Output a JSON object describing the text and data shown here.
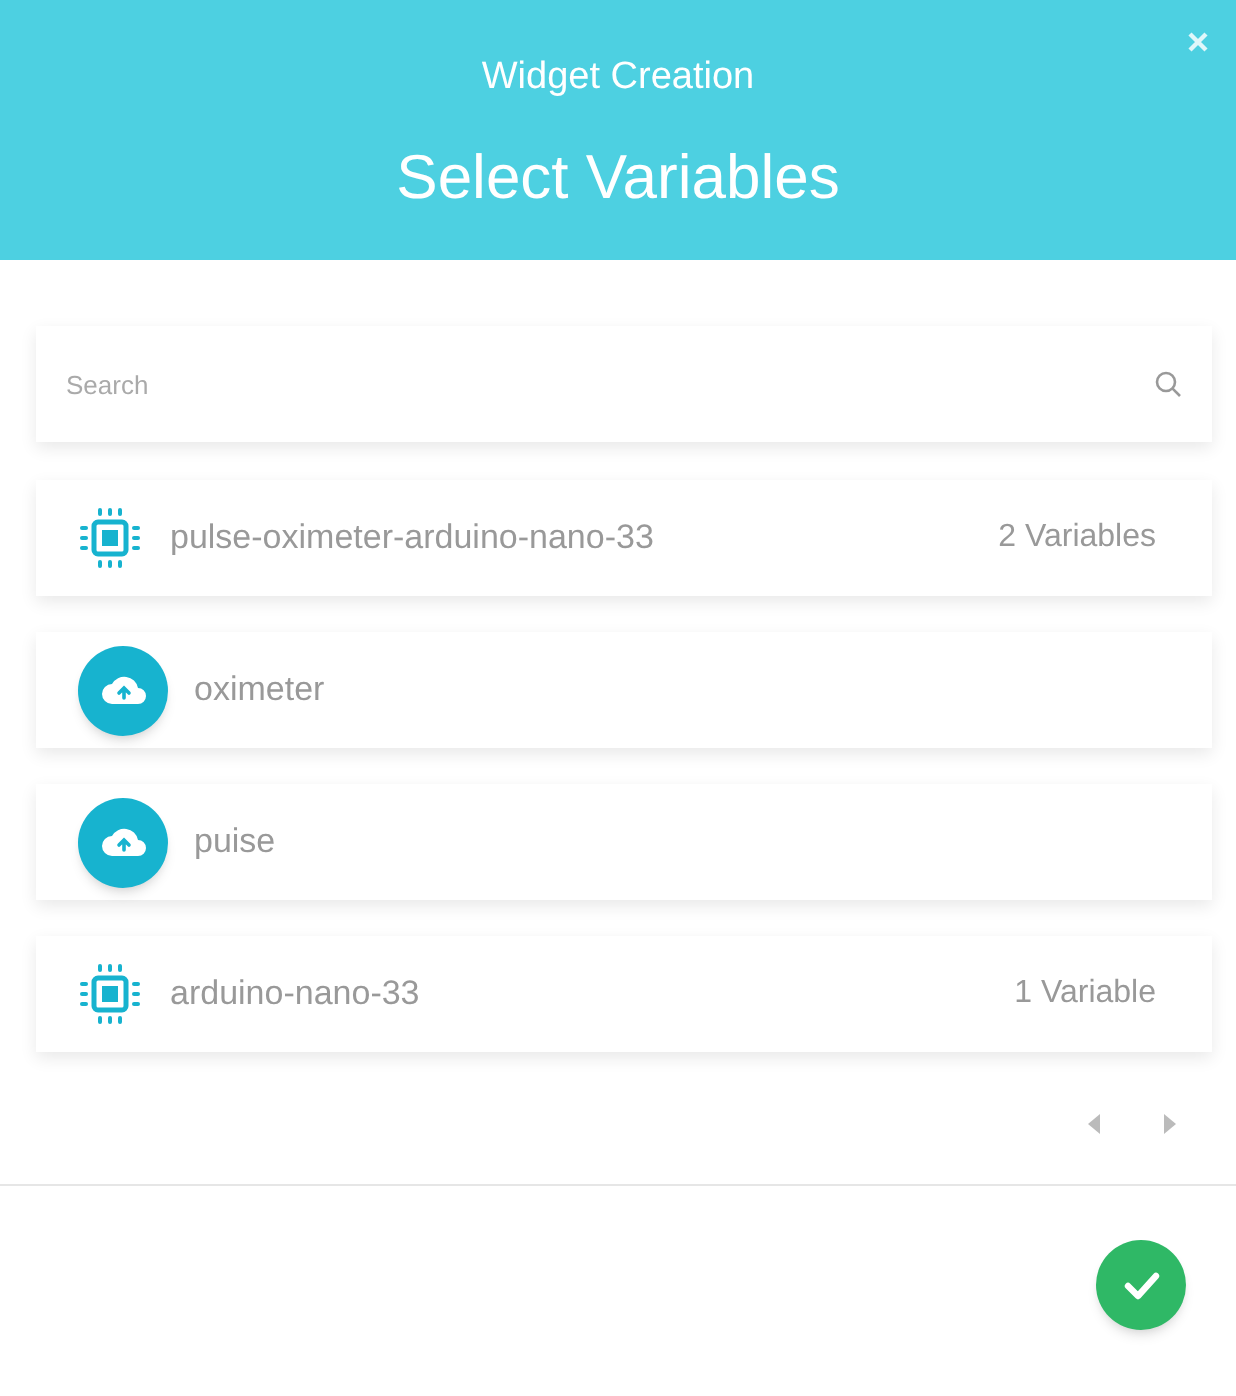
{
  "header": {
    "subtitle": "Widget Creation",
    "title": "Select Variables"
  },
  "search": {
    "placeholder": "Search"
  },
  "items": [
    {
      "kind": "device",
      "name": "pulse-oximeter-arduino-nano-33",
      "count": "2 Variables"
    },
    {
      "kind": "variable",
      "name": "oximeter"
    },
    {
      "kind": "variable",
      "name": "puise"
    },
    {
      "kind": "device",
      "name": "arduino-nano-33",
      "count": "1 Variable"
    }
  ]
}
